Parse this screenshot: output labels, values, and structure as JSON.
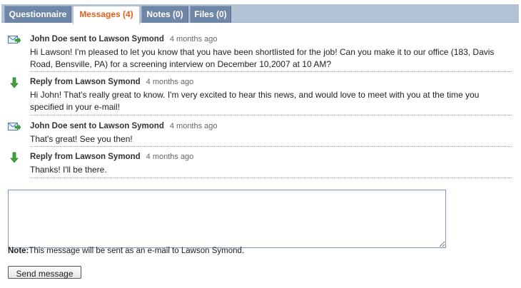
{
  "tabs": [
    {
      "label": "Questionnaire",
      "active": false
    },
    {
      "label": "Messages (4)",
      "active": true
    },
    {
      "label": "Notes (0)",
      "active": false
    },
    {
      "label": "Files (0)",
      "active": false
    }
  ],
  "messages": [
    {
      "icon": "mail-sent-icon",
      "sender": "John Doe sent to Lawson Symond",
      "time": "4 months ago",
      "body": "Hi Lawson! I'm pleased to let you know that you have been shortlisted for the job! Can you make it to our office (183, Davis Road, Bensville, PA) for a screening interview on December 10,2007 at 10 AM?"
    },
    {
      "icon": "reply-arrow-icon",
      "sender": "Reply from Lawson Symond",
      "time": "4 months ago",
      "body": "Hi John! That's really great to know. I'm very excited to hear this news, and would love to meet with you at the time you specified in your e-mail!"
    },
    {
      "icon": "mail-sent-icon",
      "sender": "John Doe sent to Lawson Symond",
      "time": "4 months ago",
      "body": "That's great! See you then!"
    },
    {
      "icon": "reply-arrow-icon",
      "sender": "Reply from Lawson Symond",
      "time": "4 months ago",
      "body": "Thanks! I'll be there."
    }
  ],
  "compose": {
    "value": "",
    "placeholder": ""
  },
  "note": {
    "label": "Note:",
    "text": "This message will be sent as an e-mail to Lawson Symond."
  },
  "send_button": {
    "label": "Send message"
  },
  "colors": {
    "active_tab_text": "#e06020",
    "tab_bg": "#6f87a6",
    "tabbar_bg": "#b3c3d6"
  }
}
